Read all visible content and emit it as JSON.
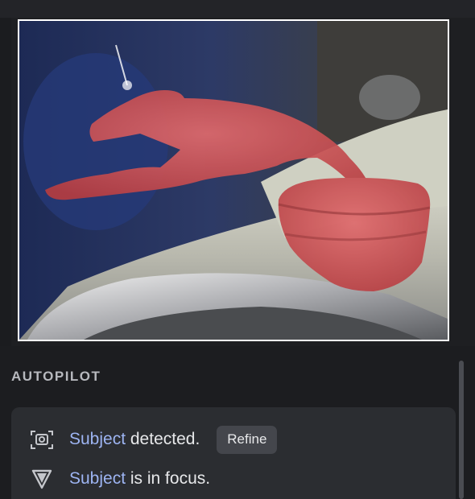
{
  "section": {
    "title": "AUTOPILOT"
  },
  "status": {
    "row1": {
      "icon": "camera-icon",
      "subject": "Subject",
      "rest": " detected.",
      "button_label": "Refine"
    },
    "row2": {
      "icon": "focus-triangle-icon",
      "subject": "Subject",
      "rest": " is in focus."
    }
  },
  "colors": {
    "accent": "#9db4f2",
    "mask": "#d04a4e",
    "panel": "#2b2d31",
    "background": "#1c1d20"
  },
  "preview": {
    "overlay": "subject mask"
  }
}
